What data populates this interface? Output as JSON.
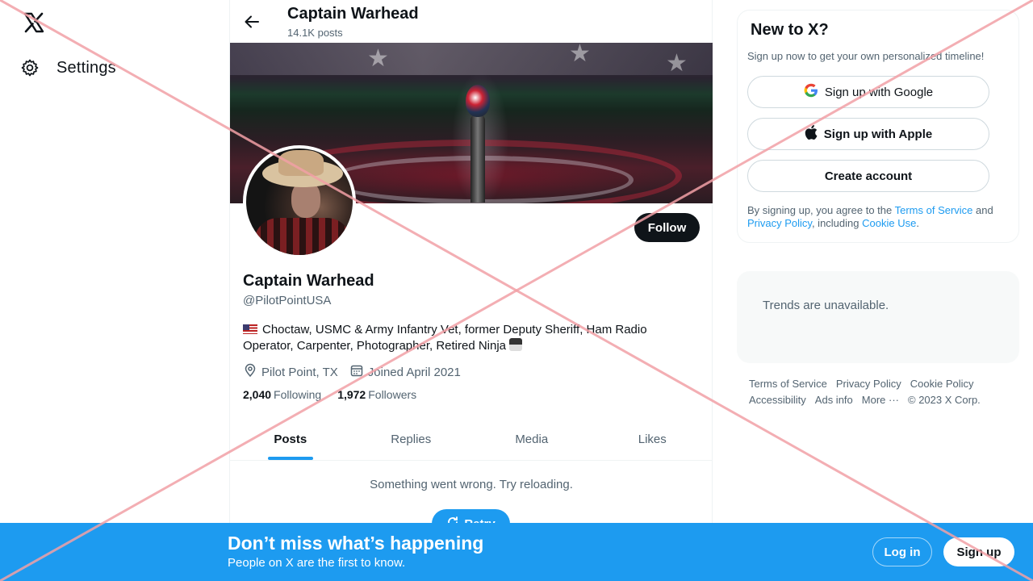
{
  "nav": {
    "logo_icon": "x-logo-icon",
    "settings_label": "Settings",
    "settings_icon": "gear-icon"
  },
  "topbar": {
    "name": "Captain Warhead",
    "posts_count": "14.1K posts"
  },
  "profile": {
    "name": "Captain Warhead",
    "handle": "@PilotPointUSA",
    "bio": "Choctaw, USMC & Army Infantry Vet, former Deputy Sheriff, Ham Radio Operator, Carpenter, Photographer, Retired Ninja",
    "location": "Pilot Point, TX",
    "joined": "Joined April 2021",
    "following_count": "2,040",
    "following_label": "Following",
    "followers_count": "1,972",
    "followers_label": "Followers",
    "follow_label": "Follow"
  },
  "tabs": [
    {
      "label": "Posts",
      "active": true
    },
    {
      "label": "Replies",
      "active": false
    },
    {
      "label": "Media",
      "active": false
    },
    {
      "label": "Likes",
      "active": false
    }
  ],
  "feed": {
    "error_text": "Something went wrong. Try reloading.",
    "retry_label": "Retry"
  },
  "signup_card": {
    "title": "New to X?",
    "subtitle": "Sign up now to get your own personalized timeline!",
    "google_label": "Sign up with Google",
    "apple_label": "Sign up with Apple",
    "create_label": "Create account",
    "legal_prefix": "By signing up, you agree to the ",
    "terms_link": "Terms of Service",
    "legal_and": " and ",
    "privacy_link": "Privacy Policy",
    "legal_including": ", including ",
    "cookie_link": "Cookie Use",
    "legal_end": "."
  },
  "trends": {
    "text": "Trends are unavailable."
  },
  "footer": {
    "links": [
      "Terms of Service",
      "Privacy Policy",
      "Cookie Policy",
      "Accessibility",
      "Ads info",
      "More ···",
      "© 2023 X Corp."
    ]
  },
  "bottombar": {
    "title": "Don’t miss what’s happening",
    "subtitle": "People on X are the first to know.",
    "login_label": "Log in",
    "signup_label": "Sign up"
  },
  "colors": {
    "accent": "#1d9bf0",
    "text_primary": "#0f1419",
    "text_secondary": "#536471",
    "overlay_x": "#f2a0a6"
  }
}
